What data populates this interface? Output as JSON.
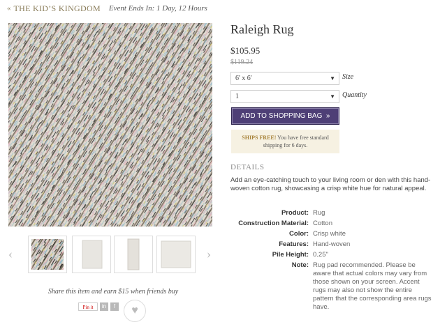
{
  "header": {
    "back_label": "THE KID’S KINGDOM",
    "back_icon": "double-chevron-left-icon",
    "event_text": "Event Ends In: 1 Day, 12 Hours"
  },
  "product": {
    "title": "Raleigh Rug",
    "price": "$105.95",
    "old_price": "$119.24",
    "size": {
      "value": "6' x 6'",
      "label": "Size"
    },
    "quantity": {
      "value": "1",
      "label": "Quantity"
    },
    "add_button": "ADD TO SHOPPING BAG",
    "add_button_icon": "double-chevron-right-icon",
    "shipping": {
      "bold": "SHIPS FREE!",
      "text": "You have free standard shipping for 6 days."
    },
    "details_heading": "DETAILS",
    "description": "Add an eye-catching touch to your living room or den with this hand-woven cotton rug, showcasing a crisp white hue for natural appeal.",
    "specs": [
      {
        "key": "Product:",
        "value": "Rug"
      },
      {
        "key": "Construction Material:",
        "value": "Cotton"
      },
      {
        "key": "Color:",
        "value": "Crisp white"
      },
      {
        "key": "Features:",
        "value": "Hand-woven"
      },
      {
        "key": "Pile Height:",
        "value": "0.25\""
      },
      {
        "key": "Note:",
        "value": "Rug pad recommended. Please be aware that actual colors may vary from those shown on your screen. Accent rugs may also not show the entire pattern that the corresponding area rugs have."
      }
    ]
  },
  "gallery": {
    "prev_icon": "chevron-left-icon",
    "next_icon": "chevron-right-icon",
    "share_text": "Share this item and earn $15 when friends buy",
    "pin_label": "Pin it",
    "social_icons": [
      "pinterest-icon",
      "linkedin-icon",
      "facebook-icon",
      "heart-icon"
    ]
  },
  "colors": {
    "accent": "#4e3f76",
    "back_link": "#8a7d5a",
    "ships_bg": "#f6f1e2"
  }
}
